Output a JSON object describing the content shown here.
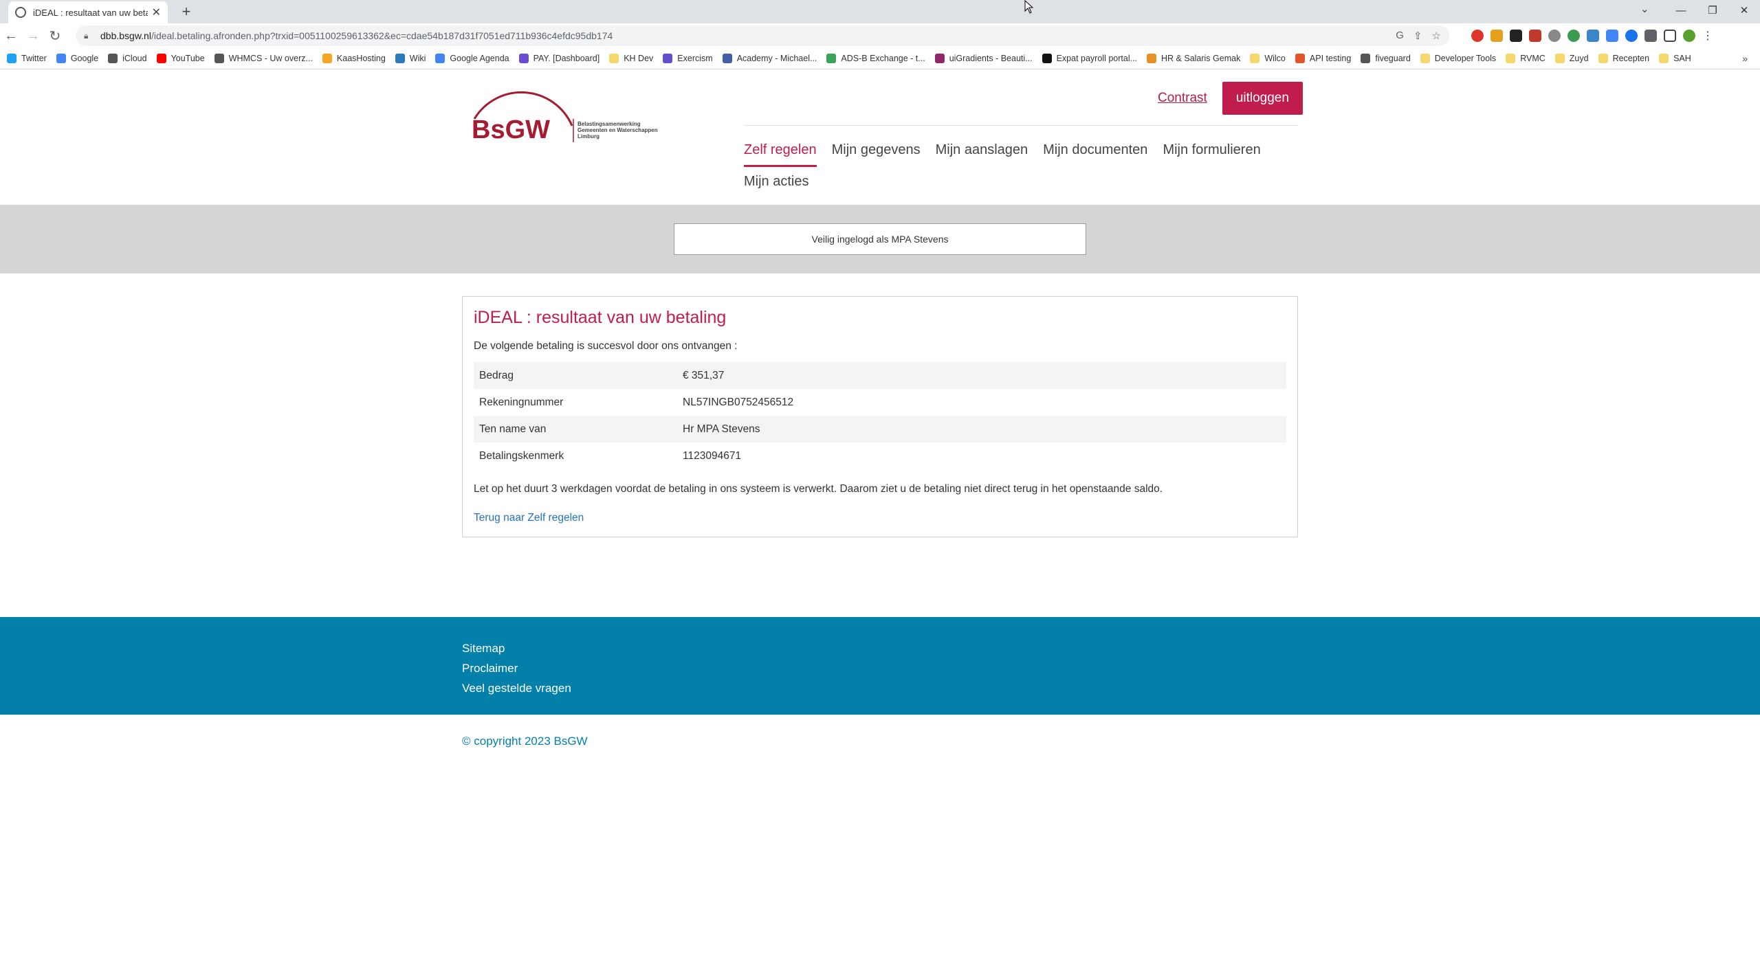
{
  "browser": {
    "tab_title": "iDEAL : resultaat van uw betaling",
    "url_host": "dbb.bsgw.nl",
    "url_path": "/ideal.betaling.afronden.php?trxid=0051100259613362&ec=cdae54b187d31f7051ed711b936c4efdc95db174",
    "bookmarks": [
      {
        "label": "Twitter",
        "color": "#1da1f2"
      },
      {
        "label": "Google",
        "color": "#4285f4"
      },
      {
        "label": "iCloud",
        "color": "#555555"
      },
      {
        "label": "YouTube",
        "color": "#ff0000"
      },
      {
        "label": "WHMCS - Uw overz...",
        "color": "#555555"
      },
      {
        "label": "KaasHosting",
        "color": "#f5a623"
      },
      {
        "label": "Wiki",
        "color": "#2b7bb9"
      },
      {
        "label": "Google Agenda",
        "color": "#4285f4"
      },
      {
        "label": "PAY. [Dashboard]",
        "color": "#6d4bd1"
      },
      {
        "label": "KH Dev",
        "color": "#f5d76e"
      },
      {
        "label": "Exercism",
        "color": "#604fcd"
      },
      {
        "label": "Academy - Michael...",
        "color": "#3f5fa8"
      },
      {
        "label": "ADS-B Exchange - t...",
        "color": "#3aa35a"
      },
      {
        "label": "uiGradients - Beauti...",
        "color": "#8e2a6b"
      },
      {
        "label": "Expat payroll portal...",
        "color": "#111111"
      },
      {
        "label": "HR & Salaris Gemak",
        "color": "#e8902a"
      },
      {
        "label": "Wilco",
        "color": "#f5d76e"
      },
      {
        "label": "API testing",
        "color": "#e2542a"
      },
      {
        "label": "fiveguard",
        "color": "#555555"
      },
      {
        "label": "Developer Tools",
        "color": "#f5d76e"
      },
      {
        "label": "RVMC",
        "color": "#f5d76e"
      },
      {
        "label": "Zuyd",
        "color": "#f5d76e"
      },
      {
        "label": "Recepten",
        "color": "#f5d76e"
      },
      {
        "label": "SAH",
        "color": "#f5d76e"
      }
    ]
  },
  "header": {
    "logo_text": "BsGW",
    "logo_sub1": "Belastingsamenwerking",
    "logo_sub2": "Gemeenten en Waterschappen",
    "logo_sub3": "Limburg",
    "contrast_label": "Contrast",
    "logout_label": "uitloggen",
    "nav": [
      "Zelf regelen",
      "Mijn gegevens",
      "Mijn aanslagen",
      "Mijn documenten",
      "Mijn formulieren"
    ],
    "nav_row2": [
      "Mijn acties"
    ]
  },
  "login_status": "Veilig ingelogd als MPA Stevens",
  "content": {
    "title": "iDEAL : resultaat van uw betaling",
    "intro": "De volgende betaling is succesvol door ons ontvangen :",
    "rows": [
      {
        "label": "Bedrag",
        "value": "€ 351,37"
      },
      {
        "label": "Rekeningnummer",
        "value": "NL57INGB0752456512"
      },
      {
        "label": "Ten name van",
        "value": "Hr MPA Stevens"
      },
      {
        "label": "Betalingskenmerk",
        "value": "1123094671"
      }
    ],
    "notice": "Let op het duurt 3 werkdagen voordat de betaling in ons systeem is verwerkt. Daarom ziet u de betaling niet direct terug in het openstaande saldo.",
    "back_link": "Terug naar Zelf regelen"
  },
  "footer": {
    "links": [
      "Sitemap",
      "Proclaimer",
      "Veel gestelde vragen"
    ],
    "copyright": "© copyright 2023 BsGW"
  },
  "colors": {
    "brand": "#c01d4d",
    "footer_bg": "#0380a9",
    "link": "#2673b5",
    "login_bar": "#d5d5d5"
  }
}
